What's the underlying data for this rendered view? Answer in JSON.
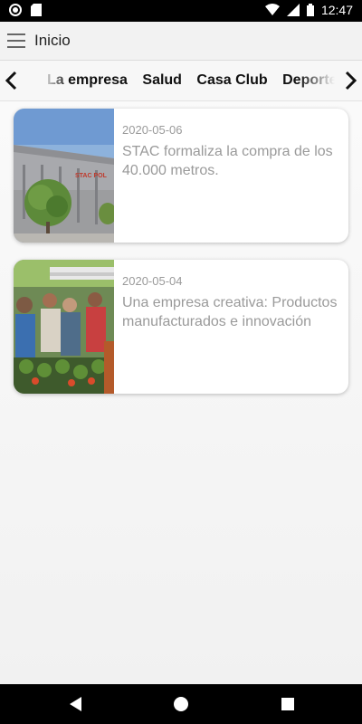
{
  "status": {
    "time": "12:47"
  },
  "app_bar": {
    "title": "Inicio"
  },
  "tabs": [
    {
      "label": "La empresa"
    },
    {
      "label": "Salud"
    },
    {
      "label": "Casa Club"
    },
    {
      "label": "Deportes"
    }
  ],
  "cards": [
    {
      "date": "2020-05-06",
      "title": "STAC formaliza la compra de los 40.000 metros.",
      "image_text": "STAC POL"
    },
    {
      "date": "2020-05-04",
      "title": "Una empresa creativa: Productos manufacturados e innovación"
    }
  ],
  "icons": {
    "menu": "hamburger-menu-icon",
    "prev": "chevron-left-icon",
    "next": "chevron-right-icon",
    "back": "back-triangle-icon",
    "home": "home-circle-icon",
    "recents": "recents-square-icon"
  },
  "colors": {
    "text_muted": "#9a9a9a",
    "status_bar": "#000000"
  }
}
